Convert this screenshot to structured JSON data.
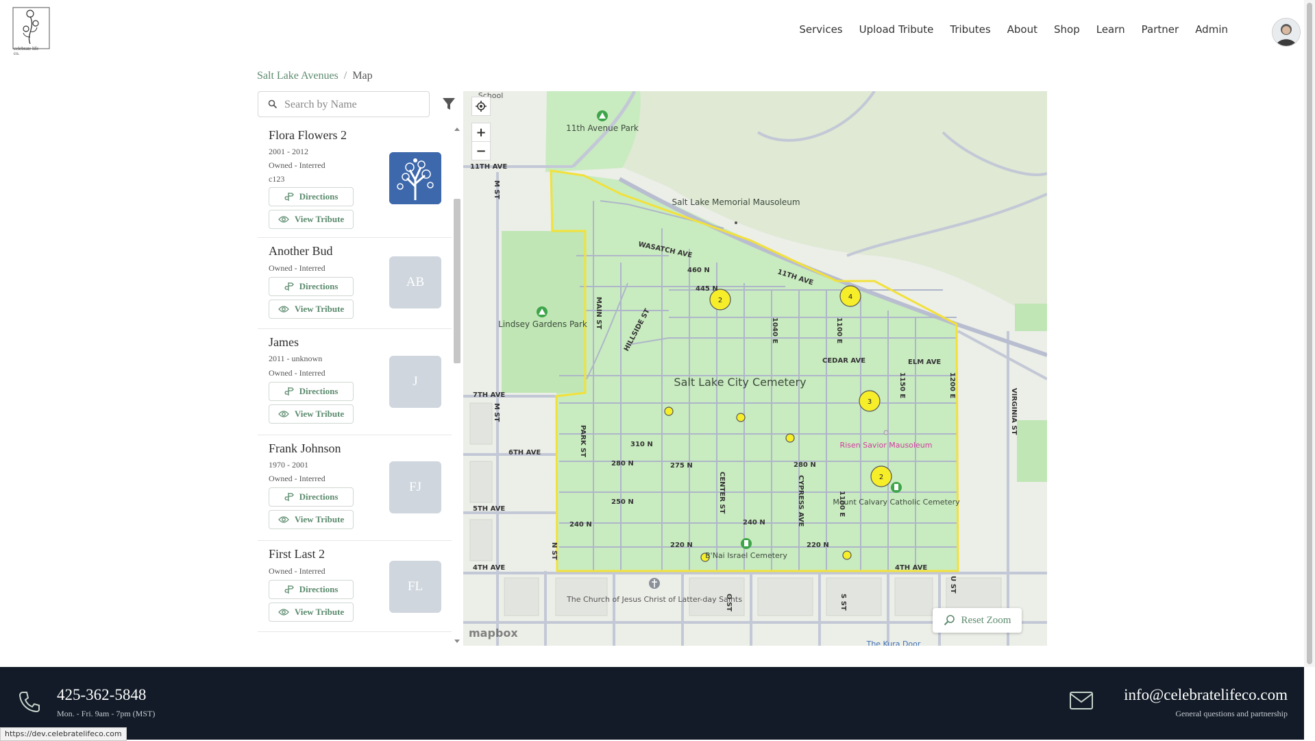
{
  "header": {
    "logo_text": "celebrate life co.",
    "nav": [
      "Services",
      "Upload Tribute",
      "Tributes",
      "About",
      "Shop",
      "Learn",
      "Partner",
      "Admin"
    ]
  },
  "breadcrumb": {
    "parent": "Salt Lake Avenues",
    "separator": "/",
    "current": "Map"
  },
  "search": {
    "placeholder": "Search by Name",
    "value": ""
  },
  "list": {
    "directions_label": "Directions",
    "view_tribute_label": "View Tribute",
    "items": [
      {
        "name": "Flora Flowers 2",
        "dates": "2001 - 2012",
        "status": "Owned - Interred",
        "plot": "c123",
        "initials": "",
        "has_image": true
      },
      {
        "name": "Another Bud",
        "dates": "",
        "status": "Owned - Interred",
        "plot": "",
        "initials": "AB",
        "has_image": false
      },
      {
        "name": "James",
        "dates": "2011 - unknown",
        "status": "Owned - Interred",
        "plot": "",
        "initials": "J",
        "has_image": false
      },
      {
        "name": "Frank Johnson",
        "dates": "1970 - 2001",
        "status": "Owned - Interred",
        "plot": "",
        "initials": "FJ",
        "has_image": false
      },
      {
        "name": "First Last 2",
        "dates": "",
        "status": "Owned - Interred",
        "plot": "",
        "initials": "FL",
        "has_image": false
      }
    ]
  },
  "map": {
    "place_labels": {
      "cemetery": "Salt Lake City Cemetery",
      "memorial_mausoleum": "Salt Lake Memorial Mausoleum",
      "eleventh_ave_park": "11th Avenue Park",
      "lindsey_gardens": "Lindsey Gardens Park",
      "risen_savior": "Risen Savior Mausoleum",
      "mount_calvary": "Mount Calvary Catholic Cemetery",
      "bnai_israel": "B'Nai Israel Cemetery",
      "lds_church": "The Church of Jesus Christ of Latter-day Saints",
      "school": "School",
      "kura_door": "The Kura Door"
    },
    "street_labels": [
      "11TH AVE",
      "WASATCH AVE",
      "460 N",
      "445 N",
      "11TH AVE",
      "CEDAR AVE",
      "ELM AVE",
      "7TH AVE",
      "6TH AVE",
      "5TH AVE",
      "4TH AVE",
      "4TH AVE",
      "310 N",
      "280 N",
      "275 N",
      "280 N",
      "250 N",
      "240 N",
      "240 N",
      "220 N",
      "220 N",
      "MAIN ST",
      "M ST",
      "M ST",
      "HILLSIDE ST",
      "1040 E",
      "1100 E",
      "1150 E",
      "1200 E",
      "PARK ST",
      "CENTER ST",
      "CYPRESS AVE",
      "1100 E",
      "VIRGINIA ST",
      "N ST",
      "O ST",
      "S ST",
      "U ST"
    ],
    "clusters": [
      "2",
      "4",
      "3",
      "2"
    ],
    "zoom_in": "+",
    "zoom_out": "−",
    "reset_zoom_label": "Reset Zoom",
    "attribution": "mapbox"
  },
  "footer": {
    "phone": "425-362-5848",
    "hours": "Mon. - Fri. 9am - 7pm (MST)",
    "email": "info@celebratelifeco.com",
    "email_note": "General questions and partnership"
  },
  "status_url": "https://dev.celebratelifeco.com",
  "colors": {
    "accent": "#5b8a6d",
    "footer_bg": "#121b27",
    "cemetery_green": "#c9ebc0",
    "boundary": "#f2e13a",
    "marker": "#f7ee2a"
  },
  "icons": [
    "search-icon",
    "filter-icon",
    "directions-icon",
    "eye-icon",
    "locate-icon",
    "zoom-icon",
    "phone-icon",
    "mail-icon"
  ]
}
